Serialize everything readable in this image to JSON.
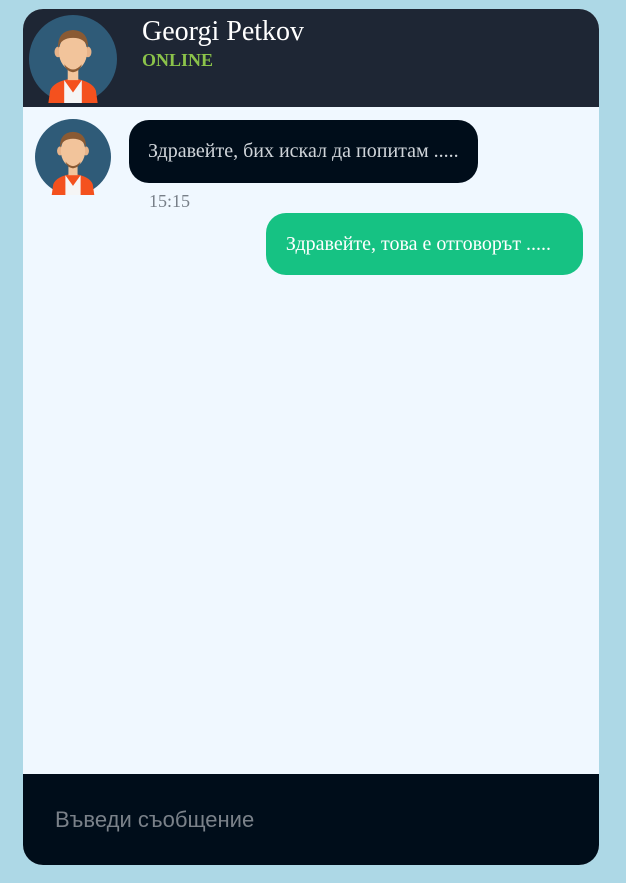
{
  "header": {
    "contact_name": "Georgi Petkov",
    "status": "ONLINE",
    "status_color": "#8bc34a",
    "avatar_icon": "male-avatar-icon"
  },
  "messages": [
    {
      "direction": "incoming",
      "text": "Здравейте, бих искал да попитам .....",
      "time": "15:15",
      "bubble_color": "#000d1a"
    },
    {
      "direction": "outgoing",
      "text": "Здравейте, това е отговорът .....",
      "bubble_color": "#16c283"
    }
  ],
  "composer": {
    "placeholder": "Въведи съобщение",
    "value": ""
  },
  "colors": {
    "page_background": "#add8e6",
    "header_background": "#1e2634",
    "chat_background": "#f0f8ff",
    "composer_background": "#000d1a"
  }
}
